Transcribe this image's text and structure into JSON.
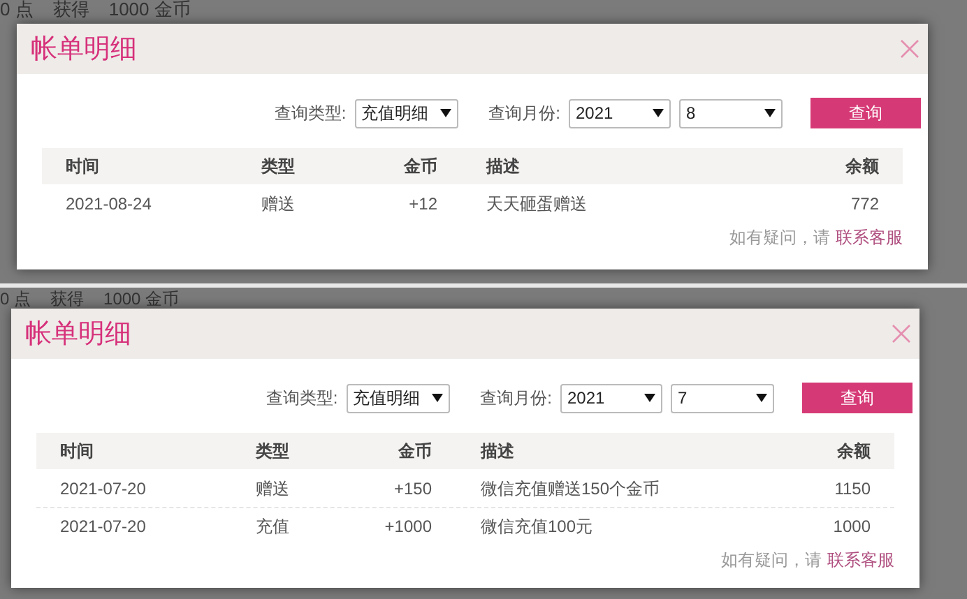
{
  "panels": [
    {
      "background_texts": [
        "0 点",
        "获得",
        "1000 金币"
      ],
      "dialog": {
        "title": "帐单明细",
        "filters": {
          "type_label": "查询类型:",
          "type_value": "充值明细",
          "month_label": "查询月份:",
          "year": "2021",
          "month": "8"
        },
        "button": "查询",
        "columns": [
          "时间",
          "类型",
          "金币",
          "描述",
          "余额"
        ],
        "rows": [
          [
            "2021-08-24",
            "赠送",
            "+12",
            "天天砸蛋赠送",
            "772"
          ]
        ],
        "footer": {
          "text": "如有疑问，请",
          "link": "联系客服"
        }
      }
    },
    {
      "background_texts": [
        "0 点",
        "获得",
        "1000 金币"
      ],
      "dialog": {
        "title": "帐单明细",
        "filters": {
          "type_label": "查询类型:",
          "type_value": "充值明细",
          "month_label": "查询月份:",
          "year": "2021",
          "month": "7"
        },
        "button": "查询",
        "columns": [
          "时间",
          "类型",
          "金币",
          "描述",
          "余额"
        ],
        "rows": [
          [
            "2021-07-20",
            "赠送",
            "+150",
            "微信充值赠送150个金币",
            "1150"
          ],
          [
            "2021-07-20",
            "充值",
            "+1000",
            "微信充值100元",
            "1000"
          ]
        ],
        "footer": {
          "text": "如有疑问，请",
          "link": "联系客服"
        }
      }
    }
  ]
}
